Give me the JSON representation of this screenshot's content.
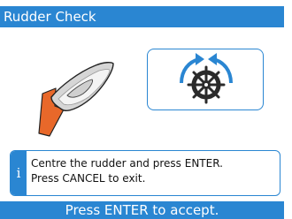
{
  "title": "Rudder Check",
  "info": {
    "icon": "info-icon",
    "icon_glyph": "i",
    "line1": "Centre the rudder and press ENTER.",
    "line2": "Press CANCEL to exit."
  },
  "footer": "Press ENTER to accept.",
  "side_code": "",
  "icons": {
    "boat": "boat-with-rudder-icon",
    "helm": "helm-wheel-rotate-icon"
  },
  "colors": {
    "accent": "#2a86d2",
    "rudder": "#e8682a",
    "boat_body": "#d9d9d9",
    "helm_dark": "#333333"
  }
}
